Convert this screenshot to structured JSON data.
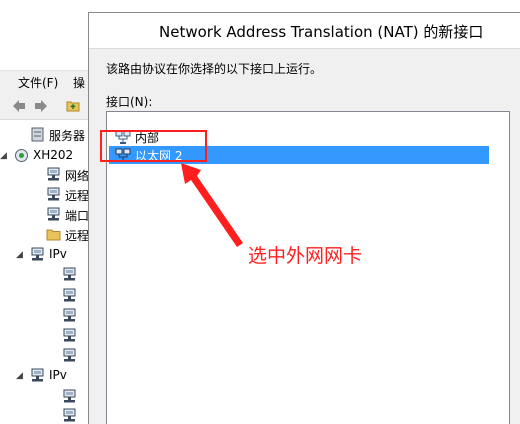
{
  "background_window": {
    "menu": [
      "文件(F)",
      "操"
    ],
    "tree": [
      {
        "label": "服务器",
        "icon": "server-icon",
        "expander": ""
      },
      {
        "label": "XH202",
        "icon": "routing-server-icon",
        "expander": "◢"
      },
      {
        "label": "网络",
        "icon": "network-icon",
        "expander": ""
      },
      {
        "label": "远程",
        "icon": "network-icon",
        "expander": ""
      },
      {
        "label": "端口",
        "icon": "network-icon",
        "expander": ""
      },
      {
        "label": "远程",
        "icon": "folder-icon",
        "expander": ""
      },
      {
        "label": "IPv",
        "icon": "network-icon",
        "expander": "◢"
      },
      {
        "label": "",
        "icon": "network-icon",
        "expander": ""
      },
      {
        "label": "",
        "icon": "network-icon",
        "expander": ""
      },
      {
        "label": "",
        "icon": "network-icon",
        "expander": ""
      },
      {
        "label": "",
        "icon": "network-icon",
        "expander": ""
      },
      {
        "label": "",
        "icon": "network-icon",
        "expander": ""
      },
      {
        "label": "IPv",
        "icon": "network-icon",
        "expander": "◢"
      },
      {
        "label": "",
        "icon": "network-icon",
        "expander": ""
      },
      {
        "label": "",
        "icon": "network-icon",
        "expander": ""
      },
      {
        "label": "",
        "icon": "network-icon",
        "expander": ""
      }
    ]
  },
  "dialog": {
    "title": "Network Address Translation (NAT) 的新接口",
    "description": "该路由协议在你选择的以下接口上运行。",
    "interfaces_label": "接口(N):",
    "interfaces": [
      {
        "label": "内部",
        "icon": "network-adapter-icon",
        "selected": false
      },
      {
        "label": "以太网 2",
        "icon": "network-adapter-icon",
        "selected": true
      }
    ]
  },
  "annotation": {
    "text": "选中外网网卡",
    "color": "#ff1f1f"
  },
  "colors": {
    "selection": "#3399ff",
    "dialog_bg": "#f0f0f0"
  }
}
